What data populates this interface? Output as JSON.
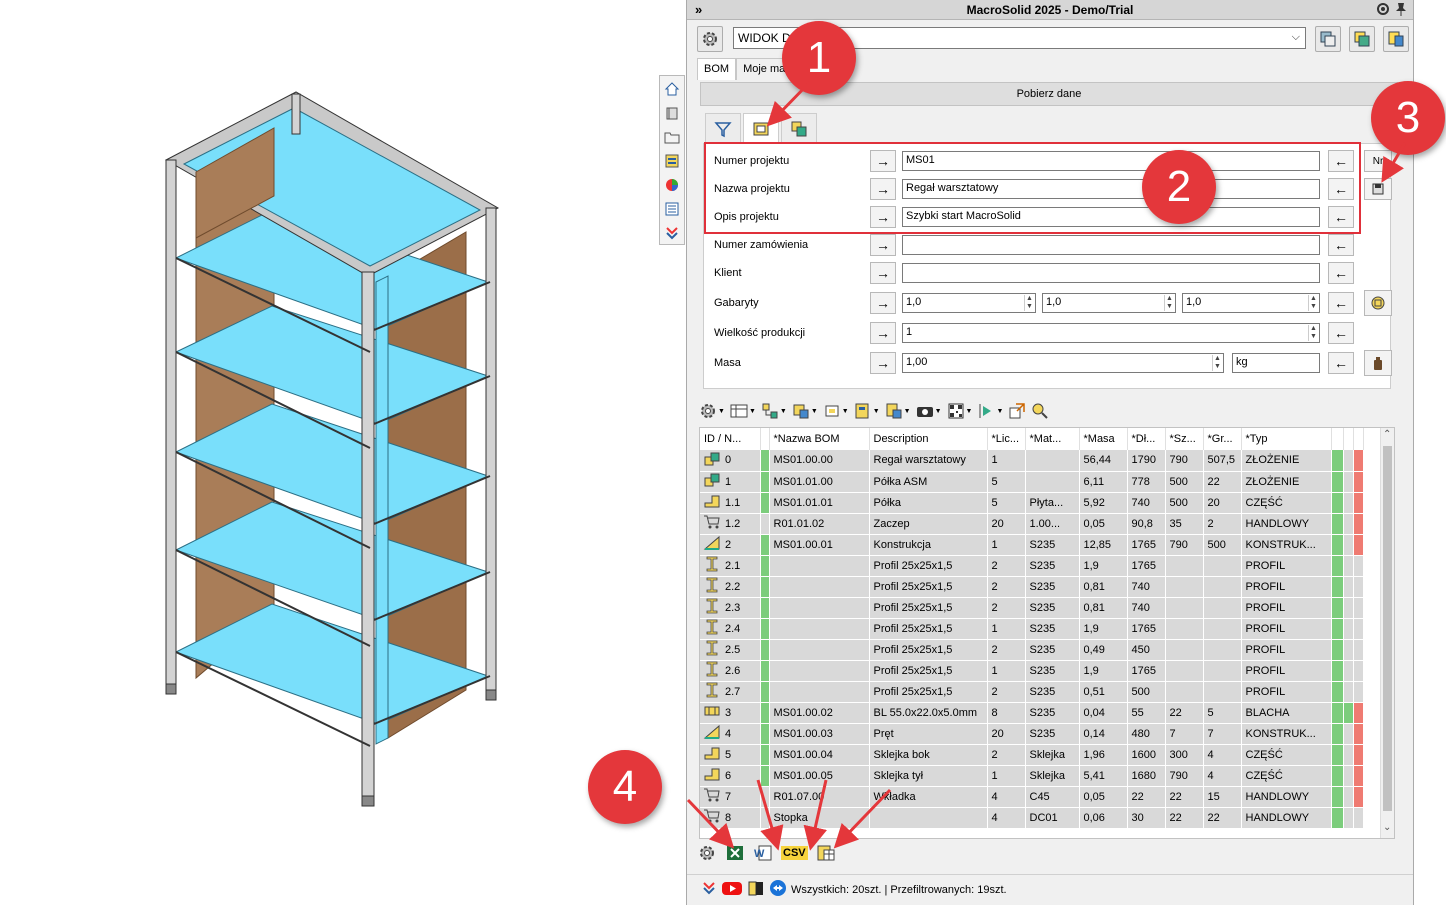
{
  "window": {
    "title": "MacroSolid 2025 - Demo/Trial"
  },
  "view_select": {
    "value": "WIDOK DO"
  },
  "tabs": [
    {
      "label": "BOM"
    },
    {
      "label": "Moje mak"
    }
  ],
  "get_data_label": "Pobierz dane",
  "form": {
    "project_number": {
      "label": "Numer projektu",
      "value": "MS01"
    },
    "project_name": {
      "label": "Nazwa projektu",
      "value": "Regał warsztatowy"
    },
    "project_desc": {
      "label": "Opis projektu",
      "value": "Szybki start MacroSolid"
    },
    "order_number": {
      "label": "Numer zamówienia",
      "value": ""
    },
    "client": {
      "label": "Klient",
      "value": ""
    },
    "dimensions": {
      "label": "Gabaryty",
      "v1": "1,0",
      "v2": "1,0",
      "v3": "1,0"
    },
    "production_size": {
      "label": "Wielkość produkcji",
      "value": "1"
    },
    "mass": {
      "label": "Masa",
      "value": "1,00",
      "unit": "kg"
    },
    "side_label": "Nr"
  },
  "table": {
    "headers": [
      "ID / N...",
      "*Nazwa BOM",
      "Description",
      "*Lic...",
      "*Mat...",
      "*Masa",
      "*Dł...",
      "*Sz...",
      "*Gr...",
      "*Typ"
    ],
    "rows": [
      {
        "icon": "assembly-icon",
        "id": "0",
        "bom": "MS01.00.00",
        "desc": "Regał warsztatowy",
        "qty": "1",
        "mat": "",
        "mass": "56,44",
        "len": "1790",
        "wid": "790",
        "gr": "507,5",
        "typ": "ZŁOŻENIE",
        "green": true,
        "red": true,
        "left": true
      },
      {
        "icon": "assembly-icon",
        "id": "1",
        "bom": "MS01.01.00",
        "desc": "Półka ASM",
        "qty": "5",
        "mat": "",
        "mass": "6,11",
        "len": "778",
        "wid": "500",
        "gr": "22",
        "typ": "ZŁOŻENIE",
        "green": true,
        "red": true,
        "left": true
      },
      {
        "icon": "part-icon",
        "id": "1.1",
        "bom": "MS01.01.01",
        "desc": "Półka",
        "qty": "5",
        "mat": "Płyta...",
        "mass": "5,92",
        "len": "740",
        "wid": "500",
        "gr": "20",
        "typ": "CZĘŚĆ",
        "green": true,
        "red": true,
        "left": true
      },
      {
        "icon": "cart-icon",
        "id": "1.2",
        "bom": "R01.01.02",
        "desc": "Zaczep",
        "qty": "20",
        "mat": "1.00...",
        "mass": "0,05",
        "len": "90,8",
        "wid": "35",
        "gr": "2",
        "typ": "HANDLOWY",
        "green": true,
        "red": true,
        "left": false
      },
      {
        "icon": "weldment-icon",
        "id": "2",
        "bom": "MS01.00.01",
        "desc": "Konstrukcja",
        "qty": "1",
        "mat": "S235",
        "mass": "12,85",
        "len": "1765",
        "wid": "790",
        "gr": "500",
        "typ": "KONSTRUK...",
        "green": true,
        "red": true,
        "left": true
      },
      {
        "icon": "profile-icon",
        "id": "2.1",
        "bom": "",
        "desc": "Profil 25x25x1,5",
        "qty": "2",
        "mat": "S235",
        "mass": "1,9",
        "len": "1765",
        "wid": "",
        "gr": "",
        "typ": "PROFIL",
        "green": true,
        "red": false,
        "left": true
      },
      {
        "icon": "profile-icon",
        "id": "2.2",
        "bom": "",
        "desc": "Profil 25x25x1,5",
        "qty": "2",
        "mat": "S235",
        "mass": "0,81",
        "len": "740",
        "wid": "",
        "gr": "",
        "typ": "PROFIL",
        "green": true,
        "red": false,
        "left": true
      },
      {
        "icon": "profile-icon",
        "id": "2.3",
        "bom": "",
        "desc": "Profil 25x25x1,5",
        "qty": "2",
        "mat": "S235",
        "mass": "0,81",
        "len": "740",
        "wid": "",
        "gr": "",
        "typ": "PROFIL",
        "green": true,
        "red": false,
        "left": true
      },
      {
        "icon": "profile-icon",
        "id": "2.4",
        "bom": "",
        "desc": "Profil 25x25x1,5",
        "qty": "1",
        "mat": "S235",
        "mass": "1,9",
        "len": "1765",
        "wid": "",
        "gr": "",
        "typ": "PROFIL",
        "green": true,
        "red": false,
        "left": true
      },
      {
        "icon": "profile-icon",
        "id": "2.5",
        "bom": "",
        "desc": "Profil 25x25x1,5",
        "qty": "2",
        "mat": "S235",
        "mass": "0,49",
        "len": "450",
        "wid": "",
        "gr": "",
        "typ": "PROFIL",
        "green": true,
        "red": false,
        "left": true
      },
      {
        "icon": "profile-icon",
        "id": "2.6",
        "bom": "",
        "desc": "Profil 25x25x1,5",
        "qty": "1",
        "mat": "S235",
        "mass": "1,9",
        "len": "1765",
        "wid": "",
        "gr": "",
        "typ": "PROFIL",
        "green": true,
        "red": false,
        "left": true
      },
      {
        "icon": "profile-icon",
        "id": "2.7",
        "bom": "",
        "desc": "Profil 25x25x1,5",
        "qty": "2",
        "mat": "S235",
        "mass": "0,51",
        "len": "500",
        "wid": "",
        "gr": "",
        "typ": "PROFIL",
        "green": true,
        "red": false,
        "left": true
      },
      {
        "icon": "sheetmetal-icon",
        "id": "3",
        "bom": "MS01.00.02",
        "desc": "BL 55.0x22.0x5.0mm",
        "qty": "8",
        "mat": "S235",
        "mass": "0,04",
        "len": "55",
        "wid": "22",
        "gr": "5",
        "typ": "BLACHA",
        "green": true,
        "red": true,
        "left": true
      },
      {
        "icon": "weldment-icon",
        "id": "4",
        "bom": "MS01.00.03",
        "desc": "Pręt",
        "qty": "20",
        "mat": "S235",
        "mass": "0,14",
        "len": "480",
        "wid": "7",
        "gr": "7",
        "typ": "KONSTRUK...",
        "green": true,
        "red": true,
        "left": true
      },
      {
        "icon": "part-icon",
        "id": "5",
        "bom": "MS01.00.04",
        "desc": "Sklejka bok",
        "qty": "2",
        "mat": "Sklejka",
        "mass": "1,96",
        "len": "1600",
        "wid": "300",
        "gr": "4",
        "typ": "CZĘŚĆ",
        "green": true,
        "red": true,
        "left": true
      },
      {
        "icon": "part-icon",
        "id": "6",
        "bom": "MS01.00.05",
        "desc": "Sklejka tył",
        "qty": "1",
        "mat": "Sklejka",
        "mass": "5,41",
        "len": "1680",
        "wid": "790",
        "gr": "4",
        "typ": "CZĘŚĆ",
        "green": true,
        "red": true,
        "left": true
      },
      {
        "icon": "cart-icon",
        "id": "7",
        "bom": "R01.07.00",
        "desc": "Wkładka",
        "qty": "4",
        "mat": "C45",
        "mass": "0,05",
        "len": "22",
        "wid": "22",
        "gr": "15",
        "typ": "HANDLOWY",
        "green": true,
        "red": true,
        "left": false
      },
      {
        "icon": "cart-icon",
        "id": "8",
        "bom": "Stopka",
        "desc": "",
        "qty": "4",
        "mat": "DC01",
        "mass": "0,06",
        "len": "30",
        "wid": "22",
        "gr": "22",
        "typ": "HANDLOWY",
        "green": true,
        "red": false,
        "left": false
      }
    ]
  },
  "status": {
    "text": "Wszystkich: 20szt. | Przefiltrowanych: 19szt."
  },
  "export": {
    "csv_label": "CSV"
  },
  "callouts": [
    "1",
    "2",
    "3",
    "4"
  ],
  "colors": {
    "accent_red": "#e4373b",
    "flag_green": "#7ccd7c",
    "flag_red": "#ef7b72",
    "shelf_blue": "#7ee0fb",
    "wood": "#a77a55"
  }
}
